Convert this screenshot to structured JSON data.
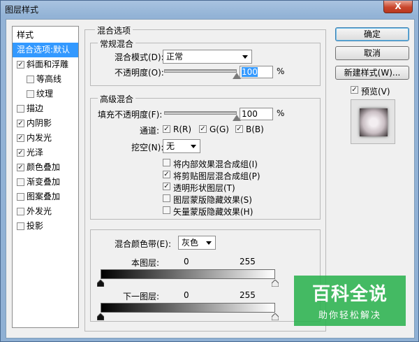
{
  "window": {
    "title": "图层样式",
    "close_label": "X"
  },
  "style_list": {
    "header": "样式",
    "items": [
      {
        "label": "混合选项:默认",
        "checked": null,
        "selected": true
      },
      {
        "label": "斜面和浮雕",
        "checked": true
      },
      {
        "label": "等高线",
        "checked": false,
        "sub": true
      },
      {
        "label": "纹理",
        "checked": false,
        "sub": true
      },
      {
        "label": "描边",
        "checked": false
      },
      {
        "label": "内阴影",
        "checked": true
      },
      {
        "label": "内发光",
        "checked": true
      },
      {
        "label": "光泽",
        "checked": true
      },
      {
        "label": "颜色叠加",
        "checked": true
      },
      {
        "label": "渐变叠加",
        "checked": false
      },
      {
        "label": "图案叠加",
        "checked": false
      },
      {
        "label": "外发光",
        "checked": false
      },
      {
        "label": "投影",
        "checked": false
      }
    ]
  },
  "blend_options": {
    "title": "混合选项",
    "general": {
      "title": "常规混合",
      "blend_mode_label": "混合模式(D):",
      "blend_mode_value": "正常",
      "opacity_label": "不透明度(O):",
      "opacity_value": "100",
      "opacity_unit": "%",
      "opacity_level": 1.0
    },
    "advanced": {
      "title": "高级混合",
      "fill_opacity_label": "填充不透明度(F):",
      "fill_opacity_value": "100",
      "fill_opacity_unit": "%",
      "fill_opacity_level": 1.0,
      "channels_label": "通道:",
      "channels": [
        {
          "label": "R(R)",
          "checked": true
        },
        {
          "label": "G(G)",
          "checked": true
        },
        {
          "label": "B(B)",
          "checked": true
        }
      ],
      "knockout_label": "挖空(N):",
      "knockout_value": "无",
      "options": [
        {
          "label": "将内部效果混合成组(I)",
          "checked": false
        },
        {
          "label": "将剪贴图层混合成组(P)",
          "checked": true
        },
        {
          "label": "透明形状图层(T)",
          "checked": true
        },
        {
          "label": "图层蒙版隐藏效果(S)",
          "checked": false
        },
        {
          "label": "矢量蒙版隐藏效果(H)",
          "checked": false
        }
      ]
    },
    "blend_if": {
      "label": "混合颜色带(E):",
      "value": "灰色",
      "this_layer_label": "本图层:",
      "this_layer_min": "0",
      "this_layer_max": "255",
      "underlying_label": "下一图层:",
      "underlying_min": "0",
      "underlying_max": "255"
    }
  },
  "buttons": {
    "ok": "确定",
    "cancel": "取消",
    "new_style": "新建样式(W)...",
    "preview_label": "预览(V)",
    "preview_checked": true
  },
  "watermark": {
    "main": "百科全说",
    "sub": "助你轻松解决"
  },
  "colors": {
    "selection": "#3399ff",
    "titlebar": "#a9c3e0",
    "close": "#c9462c",
    "watermark": "#2db350"
  }
}
